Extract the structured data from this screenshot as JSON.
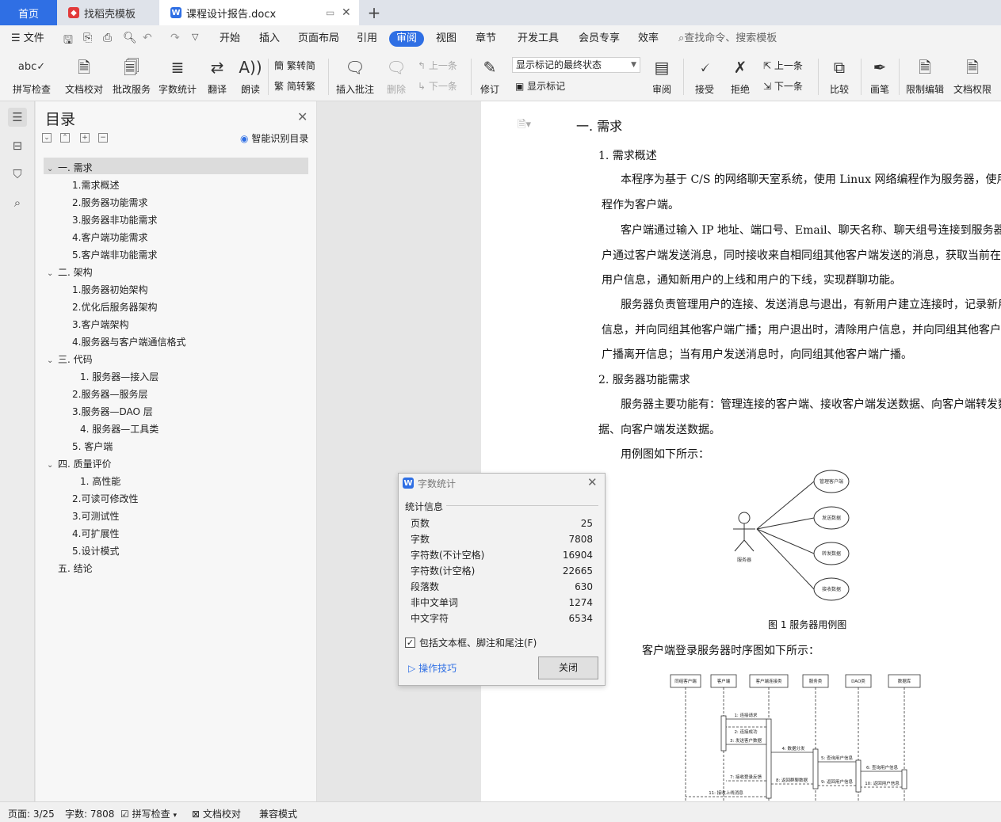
{
  "tabs": {
    "home": "首页",
    "template": "找稻壳模板",
    "document": "课程设计报告.docx",
    "add": "+"
  },
  "menubar": {
    "file": "文件",
    "items": [
      "开始",
      "插入",
      "页面布局",
      "引用",
      "审阅",
      "视图",
      "章节",
      "开发工具",
      "会员专享",
      "效率"
    ],
    "active": "审阅",
    "search_placeholder": "查找命令、搜索模板"
  },
  "ribbon": {
    "spellcheck": "拼写检查",
    "doc_check": "文档校对",
    "batch_service": "批改服务",
    "word_count": "字数统计",
    "translate": "翻译",
    "read_aloud": "朗读",
    "to_simplified": "繁转简",
    "to_traditional": "简转繁",
    "insert_comment": "插入批注",
    "delete": "删除",
    "prev": "上一条",
    "next": "下一条",
    "revise": "修订",
    "markup_state": "显示标记的最终状态",
    "show_markup": "显示标记",
    "review": "审阅",
    "accept": "接受",
    "reject": "拒绝",
    "prev2": "上一条",
    "next2": "下一条",
    "compare": "比较",
    "pen": "画笔",
    "restrict_edit": "限制编辑",
    "doc_permission": "文档权限"
  },
  "toc": {
    "title": "目录",
    "ai_label": "智能识别目录",
    "items": [
      {
        "text": "一.  需求",
        "level": 0,
        "chev": true
      },
      {
        "text": "1.需求概述",
        "level": 1
      },
      {
        "text": "2.服务器功能需求",
        "level": 1
      },
      {
        "text": "3.服务器非功能需求",
        "level": 1
      },
      {
        "text": "4.客户端功能需求",
        "level": 1
      },
      {
        "text": "5.客户端非功能需求",
        "level": 1
      },
      {
        "text": "二. 架构",
        "level": 0,
        "chev": true
      },
      {
        "text": "1.服务器初始架构",
        "level": 1
      },
      {
        "text": "2.优化后服务器架构",
        "level": 1
      },
      {
        "text": "3.客户端架构",
        "level": 1
      },
      {
        "text": "4.服务器与客户端通信格式",
        "level": 1
      },
      {
        "text": "三. 代码",
        "level": 0,
        "chev": true
      },
      {
        "text": "1. 服务器—接入层",
        "level": 2
      },
      {
        "text": "2.服务器—服务层",
        "level": 1
      },
      {
        "text": "3.服务器—DAO 层",
        "level": 1
      },
      {
        "text": "4. 服务器—工具类",
        "level": 2
      },
      {
        "text": "5. 客户端",
        "level": 1
      },
      {
        "text": "四.  质量评价",
        "level": 0,
        "chev": true
      },
      {
        "text": "1. 高性能",
        "level": 2
      },
      {
        "text": "2.可读可修改性",
        "level": 1
      },
      {
        "text": "3.可测试性",
        "level": 1
      },
      {
        "text": "4.可扩展性",
        "level": 1
      },
      {
        "text": "5.设计模式",
        "level": 1
      },
      {
        "text": "五.  结论",
        "level": 0,
        "chev": false
      }
    ]
  },
  "document": {
    "h1": "一.  需求",
    "h2_1": "1.  需求概述",
    "p1a": "本程序为基于 C/S 的网络聊天室系统，使用 Linux 网络编程作为服务器，使用 QT",
    "p1b": "程作为客户端。",
    "p2a": "客户端通过输入 IP 地址、端口号、Email、聊天名称、聊天组号连接到服务器，",
    "p2b": "户通过客户端发送消息，同时接收来自相同组其他客户端发送的消息，获取当前在",
    "p2c": "用户信息，通知新用户的上线和用户的下线，实现群聊功能。",
    "p3a": "服务器负责管理用户的连接、发送消息与退出，有新用户建立连接时，记录新用",
    "p3b": "信息，并向同组其他客户端广播；用户退出时，清除用户信息，并向同组其他客户",
    "p3c": "广播离开信息；当有用户发送消息时，向同组其他客户端广播。",
    "h2_2": "2.  服务器功能需求",
    "p4a": "服务器主要功能有：管理连接的客户端、接收客户端发送数据、向客户端转发数",
    "p4b": "据、向客户端发送数据。",
    "p5": "用例图如下所示：",
    "usecase": {
      "actor": "服务器",
      "cases": [
        "管理客户端",
        "发送数据",
        "转发数据",
        "接收数据"
      ]
    },
    "fig1_caption": "图 1 服务器用例图",
    "p6": "客户端登录服务器时序图如下所示：",
    "seq": {
      "lifelines": [
        "同组客户端",
        "客户端",
        "客户端连接类",
        "服务类",
        "DAO类",
        "数据库"
      ],
      "msgs": [
        "1: 连接请求",
        "2: 连接成功",
        "3: 发送客户数据",
        "4: 数据分发",
        "5: 查询用户信息",
        "6: 查询用户信息",
        "7: 接收登录反馈",
        "8: 返回群聊数据",
        "9: 返回用户信息",
        "10: 返回用户信息",
        "11: 接收上线消息"
      ]
    }
  },
  "dialog": {
    "title": "字数统计",
    "section": "统计信息",
    "rows": [
      {
        "label": "页数",
        "value": "25"
      },
      {
        "label": "字数",
        "value": "7808"
      },
      {
        "label": "字符数(不计空格)",
        "value": "16904"
      },
      {
        "label": "字符数(计空格)",
        "value": "22665"
      },
      {
        "label": "段落数",
        "value": "630"
      },
      {
        "label": "非中文单词",
        "value": "1274"
      },
      {
        "label": "中文字符",
        "value": "6534"
      }
    ],
    "checkbox_label": "包括文本框、脚注和尾注(F)",
    "checkbox_checked": true,
    "tips_link": "操作技巧",
    "close_button": "关闭"
  },
  "status": {
    "page": "页面: 3/25",
    "words": "字数: 7808",
    "spellcheck": "拼写检查",
    "doc_check": "文档校对",
    "compat": "兼容模式"
  },
  "colors": {
    "accent": "#2f6fe4",
    "wps_red": "#e23a3a"
  }
}
